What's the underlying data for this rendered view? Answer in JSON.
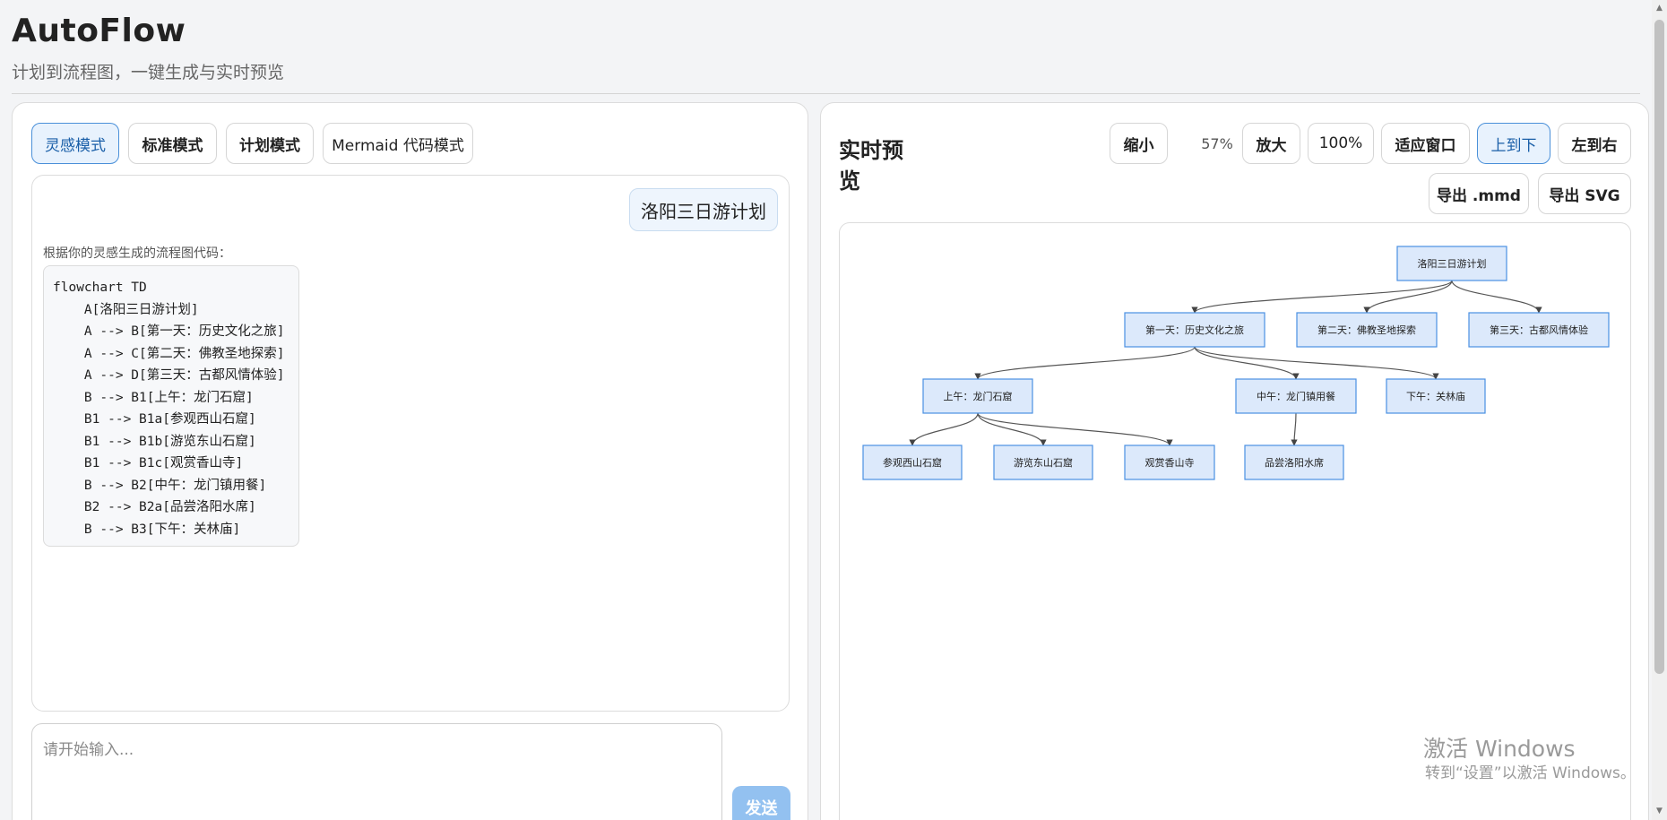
{
  "app": {
    "title": "AutoFlow",
    "subtitle": "计划到流程图，一键生成与实时预览"
  },
  "modes": [
    {
      "label": "灵感模式",
      "active": true
    },
    {
      "label": "标准模式",
      "active": false
    },
    {
      "label": "计划模式",
      "active": false
    },
    {
      "label": "Mermaid 代码模式",
      "active": false
    }
  ],
  "chat": {
    "user_message": "洛阳三日游计划",
    "bot_note": "根据你的灵感生成的流程图代码：",
    "code": "flowchart TD\n    A[洛阳三日游计划]\n    A --> B[第一天：历史文化之旅]\n    A --> C[第二天：佛教圣地探索]\n    A --> D[第三天：古都风情体验]\n    B --> B1[上午：龙门石窟]\n    B1 --> B1a[参观西山石窟]\n    B1 --> B1b[游览东山石窟]\n    B1 --> B1c[观赏香山寺]\n    B --> B2[中午：龙门镇用餐]\n    B2 --> B2a[品尝洛阳水席]\n    B --> B3[下午：关林庙]"
  },
  "input": {
    "placeholder": "请开始输入...",
    "value": "",
    "send_label": "发送"
  },
  "preview": {
    "title": "实时预览",
    "zoom_out_label": "缩小",
    "zoom_level": "57%",
    "zoom_in_label": "放大",
    "reset_label": "100%",
    "fit_label": "适应窗口",
    "top_down_label": "上到下",
    "left_right_label": "左到右",
    "export_mmd_label": "导出 .mmd",
    "export_svg_label": "导出 SVG",
    "direction": "TD"
  },
  "flowchart": {
    "node_fill": "#dce9fb",
    "node_stroke": "#4a90e2",
    "nodes": [
      {
        "id": "A",
        "label": "洛阳三日游计划"
      },
      {
        "id": "B",
        "label": "第一天：历史文化之旅"
      },
      {
        "id": "C",
        "label": "第二天：佛教圣地探索"
      },
      {
        "id": "D",
        "label": "第三天：古都风情体验"
      },
      {
        "id": "B1",
        "label": "上午：龙门石窟"
      },
      {
        "id": "B2",
        "label": "中午：龙门镇用餐"
      },
      {
        "id": "B3",
        "label": "下午：关林庙"
      },
      {
        "id": "B1a",
        "label": "参观西山石窟"
      },
      {
        "id": "B1b",
        "label": "游览东山石窟"
      },
      {
        "id": "B1c",
        "label": "观赏香山寺"
      },
      {
        "id": "B2a",
        "label": "品尝洛阳水席"
      }
    ],
    "edges": [
      [
        "A",
        "B"
      ],
      [
        "A",
        "C"
      ],
      [
        "A",
        "D"
      ],
      [
        "B",
        "B1"
      ],
      [
        "B",
        "B2"
      ],
      [
        "B",
        "B3"
      ],
      [
        "B1",
        "B1a"
      ],
      [
        "B1",
        "B1b"
      ],
      [
        "B1",
        "B1c"
      ],
      [
        "B2",
        "B2a"
      ]
    ]
  },
  "watermark": {
    "line1": "激活 Windows",
    "line2": "转到“设置”以激活 Windows。"
  },
  "colors": {
    "accent": "#4a90d9",
    "send_button": "#93c1f0",
    "active_mode_bg": "#e8f2fd"
  }
}
